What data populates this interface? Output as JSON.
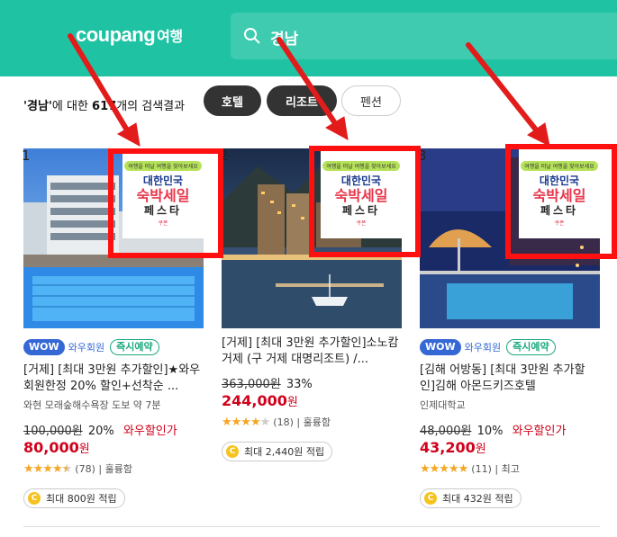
{
  "header": {
    "logo": "coupang",
    "logo_sub": "여행",
    "search_value": "경남",
    "search_icon": "search-icon"
  },
  "filter": {
    "result_query": "'경남'",
    "result_text1": "에 대한 ",
    "result_count": "617",
    "result_text2": "개의 검색결과",
    "chips": [
      "호텔",
      "리조트",
      "펜션"
    ]
  },
  "promo": {
    "bubble": "여행을 떠날 여행을 찾아보세요",
    "line1": "대한민국",
    "line2": "숙박세일",
    "line3": "페스타",
    "line4": "쿠폰"
  },
  "cards": [
    {
      "rank": "1",
      "wow": "WOW",
      "wow_text": "와우회원",
      "instant": "즉시예약",
      "title": "[거제] [최대 3만원 추가할인]★와우회원한정 20% 할인+선착순 ...",
      "location": "와현 모래숲해수욕장 도보 약 7분",
      "original_price": "100,000원",
      "discount": "20%",
      "wow_sale": "와우할인가",
      "price": "80,000",
      "price_unit": "원",
      "rating": 4.5,
      "reviews": "(78)",
      "grade": "| 훌륭함",
      "reward": "최대 800원 적립"
    },
    {
      "rank": "2",
      "title": "[거제] [최대 3만원 추가할인]소노캄 거제 (구 거제 대명리조트) /...",
      "original_price": "363,000원",
      "discount": "33%",
      "price": "244,000",
      "price_unit": "원",
      "rating": 4,
      "reviews": "(18)",
      "grade": "| 훌륭함",
      "reward": "최대 2,440원 적립"
    },
    {
      "rank": "3",
      "wow": "WOW",
      "wow_text": "와우회원",
      "instant": "즉시예약",
      "title": "[김해 어방동] [최대 3만원 추가할인]김해 아몬드키즈호텔",
      "location": "인제대학교",
      "original_price": "48,000원",
      "discount": "10%",
      "wow_sale": "와우할인가",
      "price": "43,200",
      "price_unit": "원",
      "rating": 5,
      "reviews": "(11)",
      "grade": "| 최고",
      "reward": "최대 432원 적립"
    }
  ],
  "colors": {
    "header": "#1fc3a4",
    "accent_red": "#d0021b",
    "wow_blue": "#3568d4",
    "instant_green": "#19a97f",
    "annotation": "#ff1010"
  }
}
